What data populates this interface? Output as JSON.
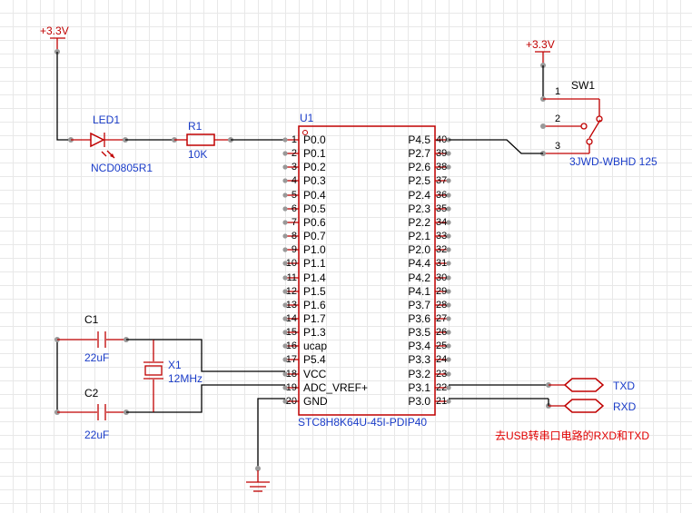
{
  "power": {
    "left_net": "+3.3V",
    "right_net": "+3.3V"
  },
  "led": {
    "ref": "LED1",
    "value": "NCD0805R1"
  },
  "resistor": {
    "ref": "R1",
    "value": "10K"
  },
  "cap1": {
    "ref": "C1",
    "value": "22uF"
  },
  "cap2": {
    "ref": "C2",
    "value": "22uF"
  },
  "crystal": {
    "ref": "X1",
    "value": "12MHz"
  },
  "switch": {
    "ref": "SW1",
    "value": "3JWD-WBHD 125",
    "pins": [
      "1",
      "2",
      "3"
    ]
  },
  "mcu": {
    "ref": "U1",
    "part": "STC8H8K64U-45I-PDIP40",
    "left_pins": [
      {
        "num": "1",
        "name": "P0.0"
      },
      {
        "num": "2",
        "name": "P0.1"
      },
      {
        "num": "3",
        "name": "P0.2"
      },
      {
        "num": "4",
        "name": "P0.3"
      },
      {
        "num": "5",
        "name": "P0.4"
      },
      {
        "num": "6",
        "name": "P0.5"
      },
      {
        "num": "7",
        "name": "P0.6"
      },
      {
        "num": "8",
        "name": "P0.7"
      },
      {
        "num": "9",
        "name": "P1.0"
      },
      {
        "num": "10",
        "name": "P1.1"
      },
      {
        "num": "11",
        "name": "P1.4"
      },
      {
        "num": "12",
        "name": "P1.5"
      },
      {
        "num": "13",
        "name": "P1.6"
      },
      {
        "num": "14",
        "name": "P1.7"
      },
      {
        "num": "15",
        "name": "P1.3"
      },
      {
        "num": "16",
        "name": "ucap"
      },
      {
        "num": "17",
        "name": "P5.4"
      },
      {
        "num": "18",
        "name": "VCC"
      },
      {
        "num": "19",
        "name": "ADC_VREF+"
      },
      {
        "num": "20",
        "name": "GND"
      }
    ],
    "right_pins": [
      {
        "num": "40",
        "name": "P4.5"
      },
      {
        "num": "39",
        "name": "P2.7"
      },
      {
        "num": "38",
        "name": "P2.6"
      },
      {
        "num": "37",
        "name": "P2.5"
      },
      {
        "num": "36",
        "name": "P2.4"
      },
      {
        "num": "35",
        "name": "P2.3"
      },
      {
        "num": "34",
        "name": "P2.2"
      },
      {
        "num": "33",
        "name": "P2.1"
      },
      {
        "num": "32",
        "name": "P2.0"
      },
      {
        "num": "31",
        "name": "P4.4"
      },
      {
        "num": "30",
        "name": "P4.2"
      },
      {
        "num": "29",
        "name": "P4.1"
      },
      {
        "num": "28",
        "name": "P3.7"
      },
      {
        "num": "27",
        "name": "P3.6"
      },
      {
        "num": "26",
        "name": "P3.5"
      },
      {
        "num": "25",
        "name": "P3.4"
      },
      {
        "num": "24",
        "name": "P3.3"
      },
      {
        "num": "23",
        "name": "P3.2"
      },
      {
        "num": "22",
        "name": "P3.1"
      },
      {
        "num": "21",
        "name": "P3.0"
      }
    ]
  },
  "ports": {
    "txd": "TXD",
    "rxd": "RXD"
  },
  "note": "去USB转串口电路的RXD和TXD",
  "colors": {
    "wire": "#000000",
    "component": "#c00000",
    "label": "#1a3cc8",
    "note": "#e00000",
    "pin_point": "#999999",
    "grid": "#e8e8e8"
  }
}
